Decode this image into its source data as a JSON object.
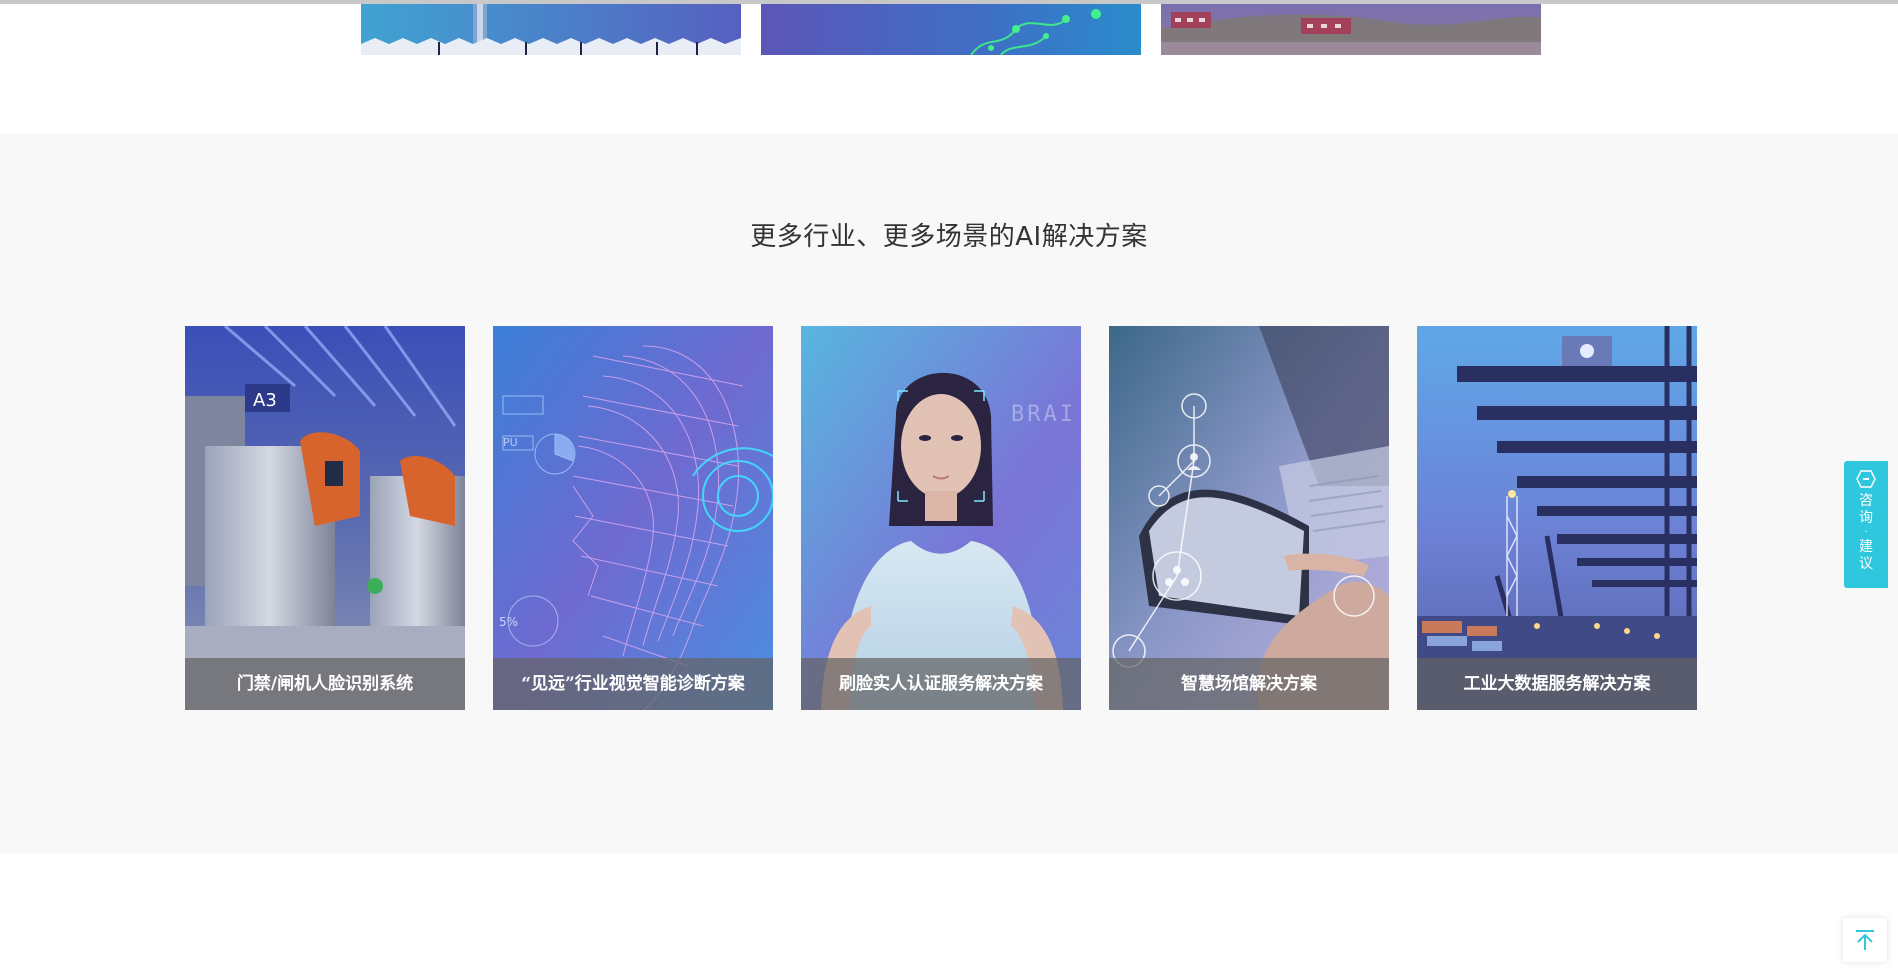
{
  "section": {
    "title": "更多行业、更多场景的AI解决方案"
  },
  "cards": [
    {
      "label": "门禁/闸机人脸识别系统",
      "image": "subway-gate-photo"
    },
    {
      "label": "“见远”行业视觉智能诊断方案",
      "image": "wireframe-face-art"
    },
    {
      "label": "刷脸实人认证服务解决方案",
      "image": "woman-face-scan-photo"
    },
    {
      "label": "智慧场馆解决方案",
      "image": "tablet-hand-network-photo"
    },
    {
      "label": "工业大数据服务解决方案",
      "image": "port-cranes-photo"
    }
  ],
  "floating": {
    "consult_chars": [
      "咨",
      "询",
      "·",
      "建",
      "议"
    ],
    "accent_color": "#2ec7dd",
    "icon": "consult-hexagon-icon"
  },
  "back_to_top": {
    "icon": "arrow-up-to-line-icon",
    "color": "#2ec7dd"
  }
}
